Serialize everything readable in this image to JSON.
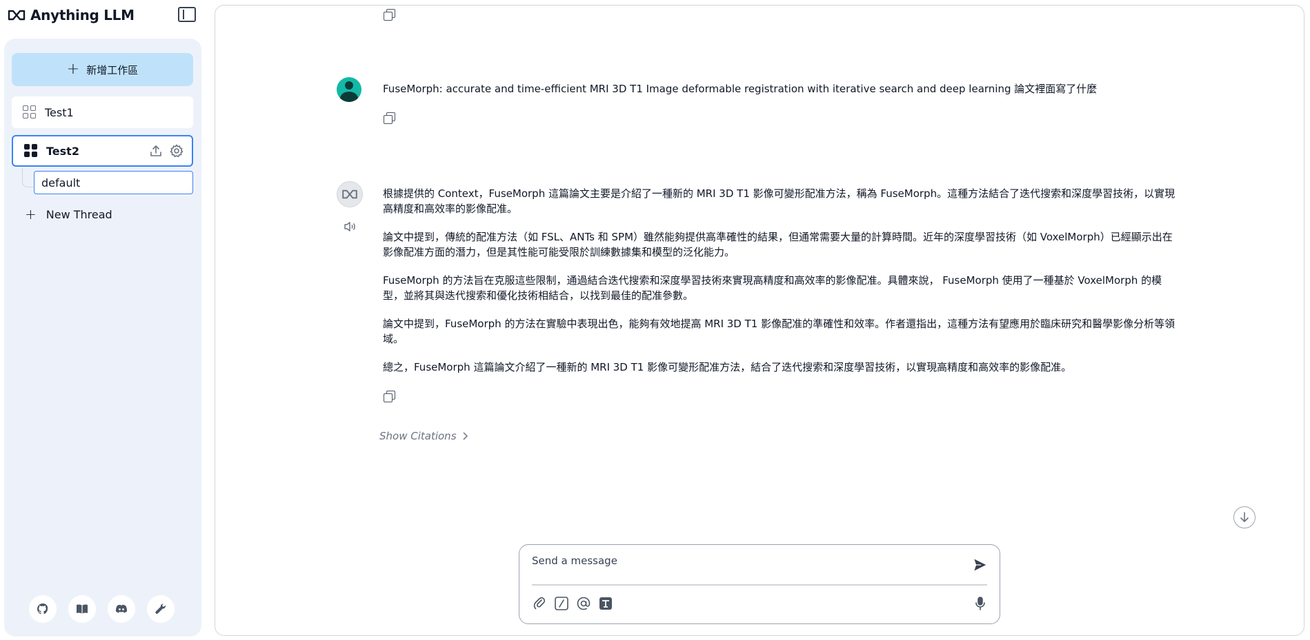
{
  "brand": {
    "name": "Anything LLM"
  },
  "sidebar": {
    "new_workspace_label": "新增工作區",
    "workspaces": [
      {
        "label": "Test1",
        "active": false
      },
      {
        "label": "Test2",
        "active": true
      }
    ],
    "threads": [
      {
        "label": "default",
        "active": true
      }
    ],
    "new_thread_label": "New Thread",
    "footer_icons": [
      "github-icon",
      "book-icon",
      "discord-icon",
      "wrench-icon"
    ]
  },
  "chat": {
    "user_message": "FuseMorph: accurate and time-efficient MRI 3D T1 Image deformable registration with iterative search and deep learning 論文裡面寫了什麼",
    "assistant_paragraphs": [
      "根據提供的 Context，FuseMorph 這篇論文主要是介紹了一種新的 MRI 3D T1 影像可變形配准方法，稱為 FuseMorph。這種方法結合了迭代搜索和深度學習技術，以實現高精度和高效率的影像配准。",
      "論文中提到，傳統的配准方法（如 FSL、ANTs 和 SPM）雖然能夠提供高準確性的結果，但通常需要大量的計算時間。近年的深度學習技術（如 VoxelMorph）已經顯示出在影像配准方面的潛力，但是其性能可能受限於訓練數據集和模型的泛化能力。",
      "FuseMorph 的方法旨在克服這些限制，通過結合迭代搜索和深度學習技術來實現高精度和高效率的影像配准。具體來說， FuseMorph 使用了一種基於 VoxelMorph 的模型，並將其與迭代搜索和優化技術相結合，以找到最佳的配准參數。",
      "論文中提到，FuseMorph 的方法在實驗中表現出色，能夠有效地提高 MRI 3D T1 影像配准的準確性和效率。作者還指出，這種方法有望應用於臨床研究和醫學影像分析等領域。",
      "總之，FuseMorph 這篇論文介紹了一種新的 MRI 3D T1 影像可變形配准方法，結合了迭代搜索和深度學習技術，以實現高精度和高效率的影像配准。"
    ],
    "show_citations_label": "Show Citations"
  },
  "composer": {
    "placeholder": "Send a message"
  },
  "colors": {
    "accent": "#3b82f6",
    "new_workspace_bg": "#bfe2fa",
    "sidebar_panel_bg": "#edf2fa",
    "user_avatar": "#14b8a6"
  }
}
